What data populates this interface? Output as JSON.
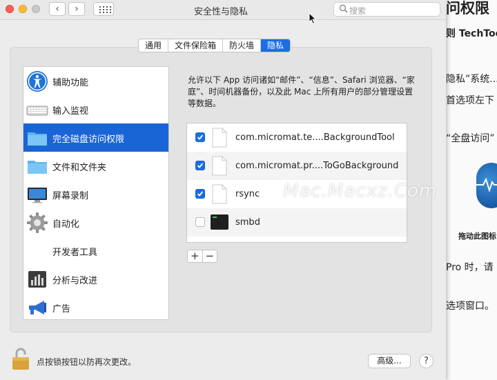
{
  "window": {
    "title": "安全性与隐私",
    "search_placeholder": "搜索",
    "back_symbol": "‹",
    "forward_symbol": "›"
  },
  "tabs": [
    {
      "label": "通用",
      "active": false
    },
    {
      "label": "文件保险箱",
      "active": false
    },
    {
      "label": "防火墙",
      "active": false
    },
    {
      "label": "隐私",
      "active": true
    }
  ],
  "sidebar": {
    "items": [
      {
        "label": "辅助功能",
        "icon": "accessibility-icon"
      },
      {
        "label": "输入监视",
        "icon": "keyboard-icon"
      },
      {
        "label": "完全磁盘访问权限",
        "icon": "folder-icon",
        "selected": true
      },
      {
        "label": "文件和文件夹",
        "icon": "folder-icon"
      },
      {
        "label": "屏幕录制",
        "icon": "display-icon"
      },
      {
        "label": "自动化",
        "icon": "gear-icon"
      },
      {
        "label": "开发者工具",
        "icon": ""
      },
      {
        "label": "分析与改进",
        "icon": "chart-icon"
      },
      {
        "label": "广告",
        "icon": "megaphone-icon"
      }
    ]
  },
  "main": {
    "description": "允许以下 App 访问诸如“邮件”、“信息”、Safari 浏览器、“家庭”、时间机器备份，以及此 Mac 上所有用户的部分管理设置等数据。",
    "apps": [
      {
        "name": "com.micromat.te....BackgroundTool",
        "checked": true
      },
      {
        "name": "com.micromat.pr....ToGoBackground",
        "checked": true
      },
      {
        "name": "rsync",
        "checked": true
      },
      {
        "name": "smbd",
        "checked": false
      }
    ],
    "add_label": "+",
    "remove_label": "−"
  },
  "footer": {
    "lock_text": "点按锁按钮以防再次更改。",
    "advanced_label": "高级...",
    "help_label": "?"
  },
  "watermark": "Mac.Macxz.Com",
  "background_doc": {
    "line1": "问权限",
    "line2": "则 TechToo",
    "line3": "隐私”系统...",
    "line4": "首选项左下",
    "line5": "“全盘访问”",
    "caption": "拖动此图标",
    "line6": "Pro 时，请",
    "line7": "选项窗口。"
  },
  "colors": {
    "accent": "#1a6ee4",
    "selection": "#1a65d6"
  }
}
